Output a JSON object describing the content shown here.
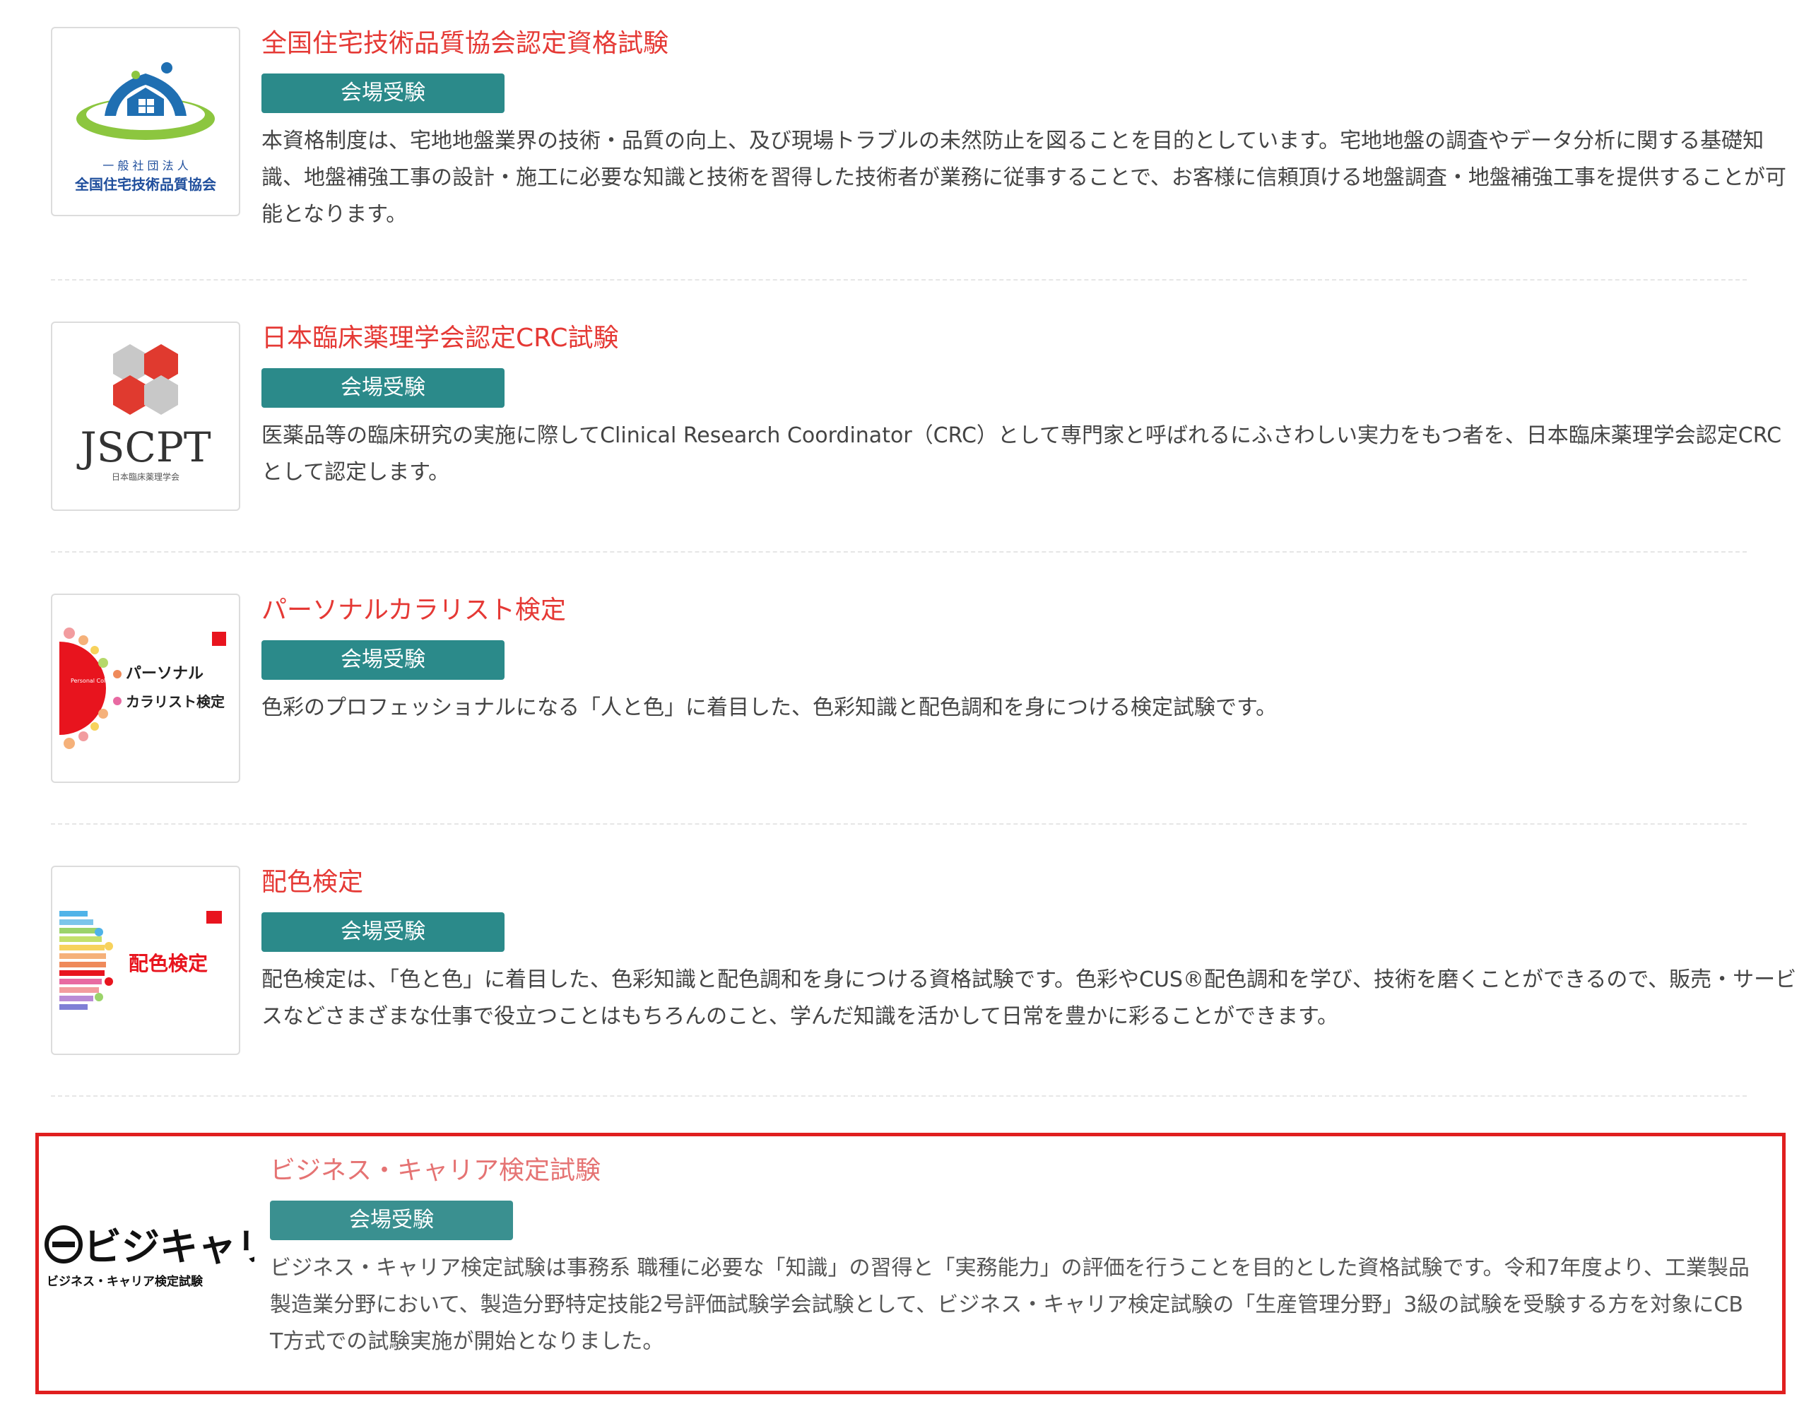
{
  "items": [
    {
      "title": "全国住宅技術品質協会認定資格試験",
      "badge": "会場受験",
      "description": "本資格制度は、宅地地盤業界の技術・品質の向上、及び現場トラブルの未然防止を図ることを目的としています。宅地地盤の調査やデータ分析に関する基礎知識、地盤補強工事の設計・施工に必要な知識と技術を習得した技術者が業務に従事することで、お客様に信頼頂ける地盤調査・地盤補強工事を提供することが可能となります。",
      "logo": {
        "line1": "一 般 社 団 法 人",
        "line2": "全国住宅技術品質協会"
      }
    },
    {
      "title": "日本臨床薬理学会認定CRC試験",
      "badge": "会場受験",
      "description": "医薬品等の臨床研究の実施に際してClinical Research Coordinator（CRC）として専門家と呼ばれるにふさわしい実力をもつ者を、日本臨床薬理学会認定CRCとして認定します。",
      "logo": {
        "line1": "JSCPT",
        "line2": "日本臨床薬理学会"
      }
    },
    {
      "title": "パーソナルカラリスト検定",
      "badge": "会場受験",
      "description": "色彩のプロフェッショナルになる「人と色」に着目した、色彩知識と配色調和を身につける検定試験です。",
      "logo": {
        "line1": "パーソナル",
        "line2": "カラリスト検定",
        "circle_text": "Personal Colorist"
      }
    },
    {
      "title": "配色検定",
      "badge": "会場受験",
      "description": "配色検定は、「色と色」に着目した、色彩知識と配色調和を身につける資格試験です。色彩やCUS®配色調和を学び、技術を磨くことができるので、販売・サービスなどさまざまな仕事で役立つことはもちろんのこと、学んだ知識を活かして日常を豊かに彩ることができます。",
      "logo": {
        "line1": "配色検定"
      }
    },
    {
      "title": "ビジネス・キャリア検定試験",
      "badge": "会場受験",
      "description": "ビジネス・キャリア検定試験は事務系 職種に必要な「知識」の習得と「実務能力」の評価を行うことを目的とした資格試験です。令和7年度より、工業製品製造業分野において、製造分野特定技能2号評価試験学会試験として、ビジネス・キャリア検定試験の「生産管理分野」3級の試験を受験する方を対象にCBT方式での試験実施が開始となりました。",
      "logo": {
        "line1": "ビジキャリ",
        "line2": "ビジネス・キャリア検定試験"
      }
    }
  ],
  "colors": {
    "title": "#e53935",
    "badge": "#2b8a8a",
    "highlight": "#e01f1f"
  }
}
